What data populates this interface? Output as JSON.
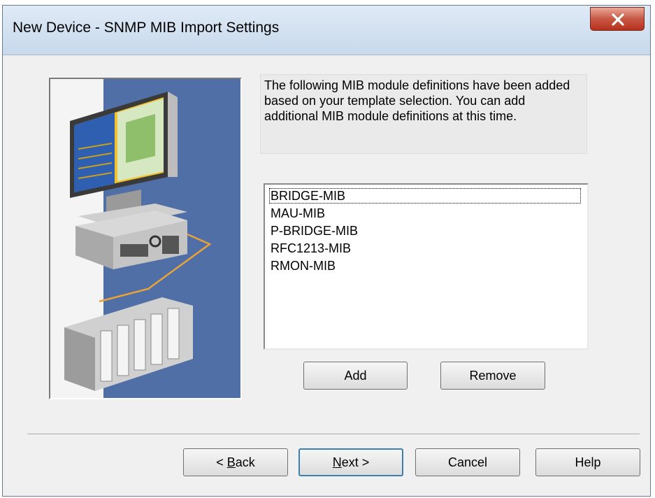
{
  "window": {
    "title": "New Device - SNMP MIB Import Settings"
  },
  "info_text": "The following MIB module definitions have been added based on your template selection. You can add additional MIB module definitions at this time.",
  "mib_list": {
    "items": [
      "BRIDGE-MIB",
      "MAU-MIB",
      "P-BRIDGE-MIB",
      "RFC1213-MIB",
      "RMON-MIB"
    ],
    "focused_item": "BRIDGE-MIB"
  },
  "buttons": {
    "add": "Add",
    "remove": "Remove",
    "back_prefix": "< ",
    "back_mnemonic": "B",
    "back_rest": "ack",
    "next_mnemonic": "N",
    "next_rest": "ext >",
    "cancel": "Cancel",
    "help": "Help"
  },
  "colors": {
    "art_background": "#4f6fa6",
    "close_button": "#c75845",
    "default_button_border": "#3c7fb1"
  },
  "icons": {
    "close": "close-x-icon",
    "illustration": "computer-and-plc-illustration"
  }
}
